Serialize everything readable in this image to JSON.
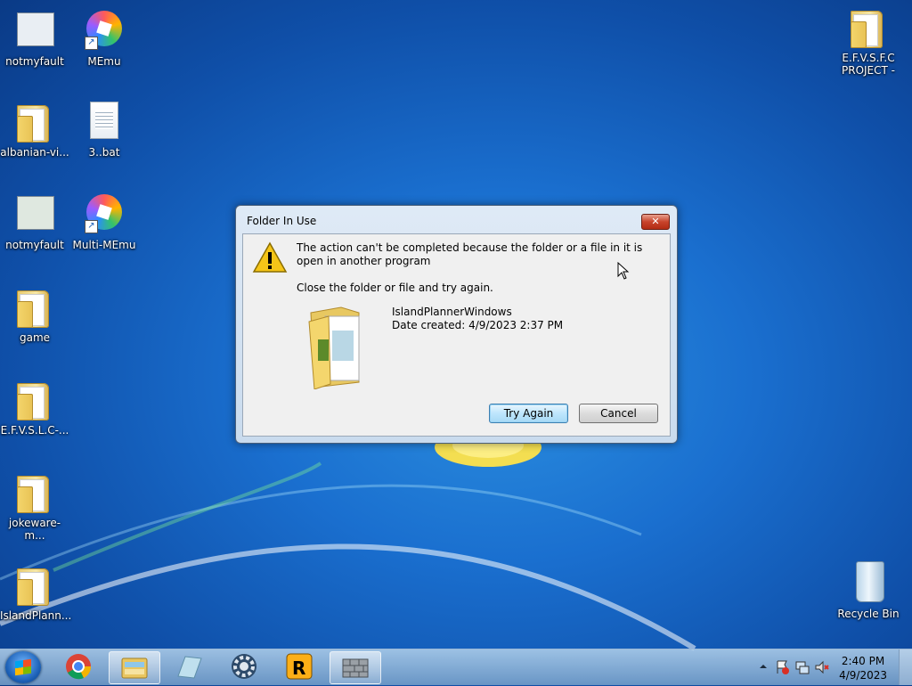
{
  "desktop": {
    "icons": [
      {
        "label": "notmyfault",
        "icon": "app-settings-icon"
      },
      {
        "label": "MEmu",
        "icon": "memu-icon"
      },
      {
        "label": "albanian-vi...",
        "icon": "folder-icon"
      },
      {
        "label": "3..bat",
        "icon": "batch-file-icon"
      },
      {
        "label": "notmyfault",
        "icon": "app-window-icon"
      },
      {
        "label": "Multi-MEmu",
        "icon": "multi-memu-icon"
      },
      {
        "label": "game",
        "icon": "folder-icon"
      },
      {
        "label": "E.F.V.S.L.C-...",
        "icon": "folder-icon"
      },
      {
        "label": "jokeware-m...",
        "icon": "folder-icon"
      },
      {
        "label": "IslandPlann...",
        "icon": "folder-icon"
      },
      {
        "label": "E.F.V.S.F.C PROJECT -",
        "icon": "folder-icon"
      },
      {
        "label": "Recycle Bin",
        "icon": "recycle-bin-icon"
      }
    ]
  },
  "dialog": {
    "title": "Folder In Use",
    "message": "The action can't be completed because the folder or a file in it is open in another program",
    "instruction": "Close the folder or file and try again.",
    "file_name": "IslandPlannerWindows",
    "file_date": "Date created: 4/9/2023 2:37 PM",
    "try_again_label": "Try Again",
    "cancel_label": "Cancel",
    "close_glyph": "✕"
  },
  "taskbar": {
    "buttons": [
      "start-orb-icon",
      "chrome-icon",
      "explorer-icon",
      "notepad-icon",
      "settings-gear-icon",
      "rockstar-icon",
      "wall-icon"
    ],
    "tray": {
      "time": "2:40 PM",
      "date": "4/9/2023"
    }
  }
}
